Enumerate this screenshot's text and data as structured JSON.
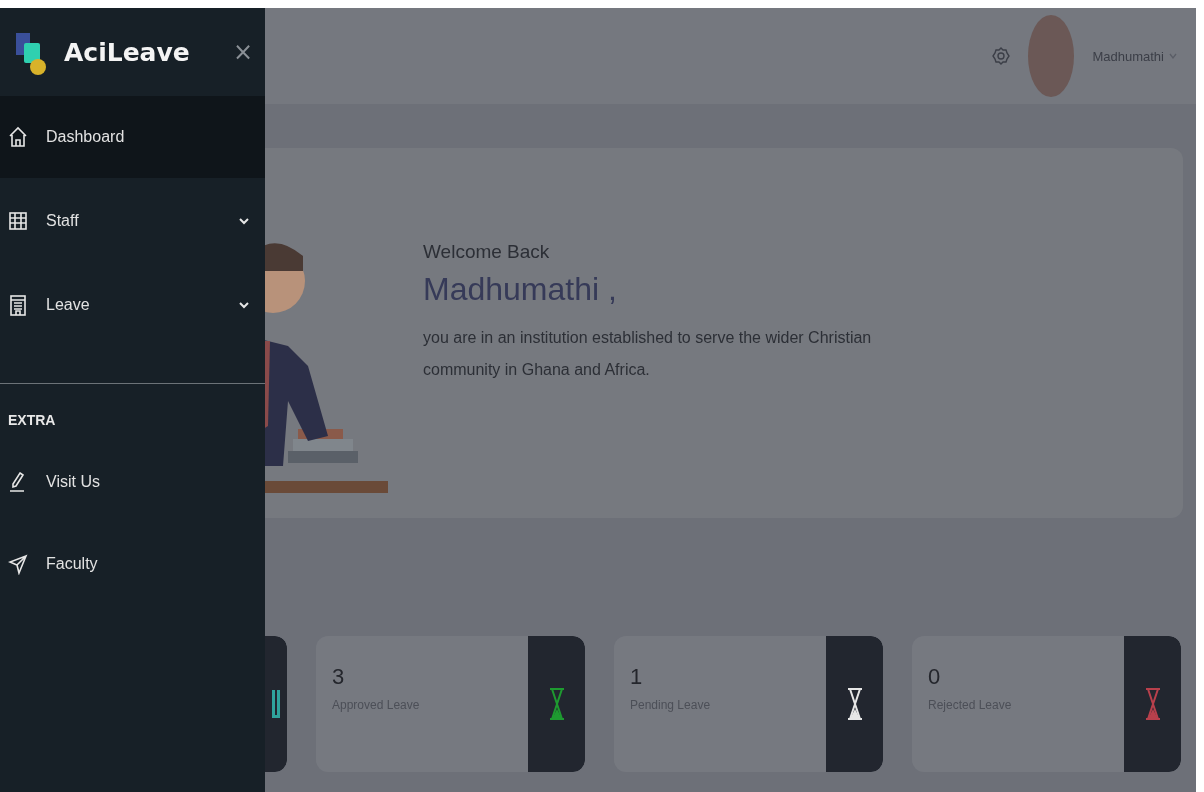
{
  "sidebar": {
    "brand": "AciLeave",
    "close": "×",
    "items": [
      {
        "label": "Dashboard",
        "has_submenu": false,
        "selected": true
      },
      {
        "label": "Staff",
        "has_submenu": true,
        "selected": false
      },
      {
        "label": "Leave",
        "has_submenu": true,
        "selected": false
      }
    ],
    "section_title": "EXTRA",
    "extra_items": [
      {
        "label": "Visit Us",
        "selected": false
      },
      {
        "label": "Faculty",
        "selected": false
      }
    ]
  },
  "header": {
    "user_name": "Madhumathi"
  },
  "welcome": {
    "greeting": "Welcome Back",
    "name": "Madhumathi ,",
    "message": "you are in an institution established to serve the wider Christian community in Ghana and Africa."
  },
  "stats": [
    {
      "kind": "partial",
      "color": "#2fa39c"
    },
    {
      "kind": "full",
      "value": "3",
      "label": "Approved Leave",
      "color": "#1e9a30"
    },
    {
      "kind": "full",
      "value": "1",
      "label": "Pending Leave",
      "color": "#e6e6e6"
    },
    {
      "kind": "full",
      "value": "0",
      "label": "Rejected Leave",
      "color": "#b8404c"
    }
  ]
}
